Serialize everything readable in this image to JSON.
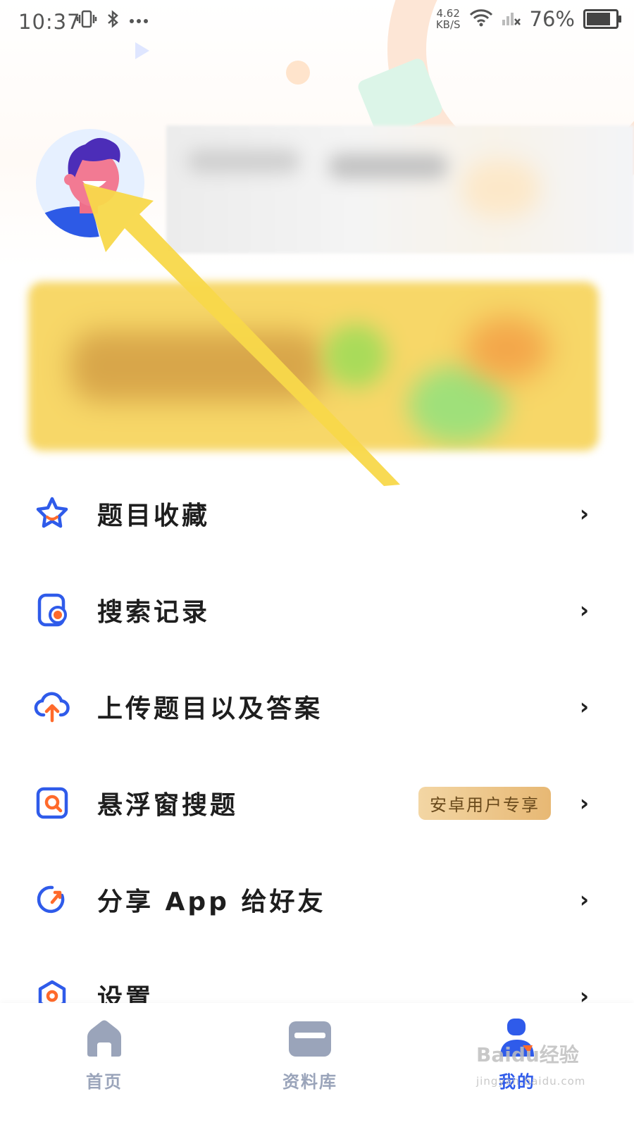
{
  "status_bar": {
    "time": "10:37",
    "net_speed_value": "4.62",
    "net_speed_unit": "KB/S",
    "battery": "76%"
  },
  "profile": {
    "avatar_icon": "user-avatar"
  },
  "menu": {
    "items": [
      {
        "label": "题目收藏",
        "icon": "star-icon"
      },
      {
        "label": "搜索记录",
        "icon": "history-icon"
      },
      {
        "label": "上传题目以及答案",
        "icon": "upload-cloud-icon"
      },
      {
        "label": "悬浮窗搜题",
        "icon": "floating-search-icon",
        "badge": "安卓用户专享"
      },
      {
        "label": "分享 App 给好友",
        "icon": "share-icon"
      },
      {
        "label": "设置",
        "icon": "settings-icon"
      }
    ]
  },
  "tabbar": {
    "tabs": [
      {
        "label": "首页",
        "icon": "home-icon",
        "active": false
      },
      {
        "label": "资料库",
        "icon": "folder-icon",
        "active": false
      },
      {
        "label": "我的",
        "icon": "profile-icon",
        "active": true
      }
    ]
  },
  "watermark": {
    "text": "Baidu经验",
    "sub": "jingyan.baidu.com"
  },
  "colors": {
    "accent": "#2f5bea",
    "secondary": "#ff6a2b",
    "badge_bg": "#eec78e",
    "tab_inactive": "#9aa4ba"
  }
}
